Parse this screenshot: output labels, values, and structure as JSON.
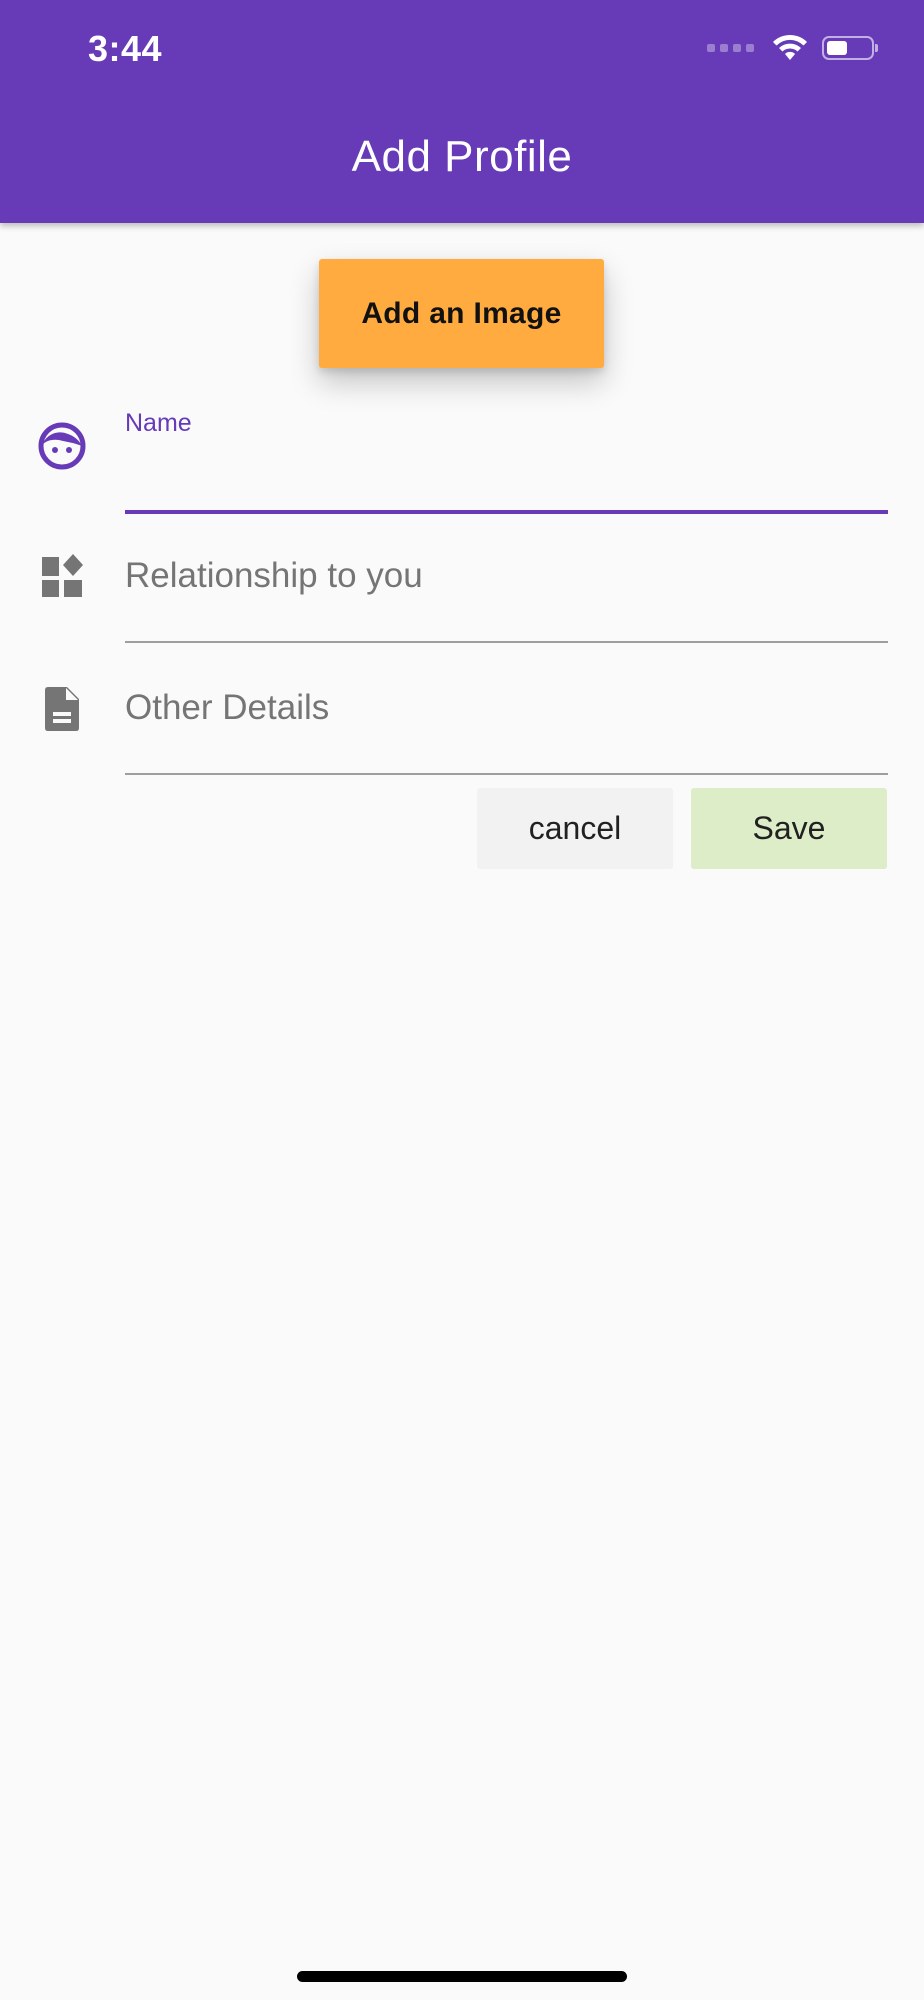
{
  "status_bar": {
    "time": "3:44"
  },
  "app_bar": {
    "title": "Add Profile",
    "color": "#673ab7"
  },
  "add_image_button": {
    "label": "Add an Image",
    "color": "#ffab40"
  },
  "form": {
    "name": {
      "label": "Name",
      "value": "",
      "icon": "face-icon"
    },
    "relationship": {
      "placeholder": "Relationship to you",
      "value": "",
      "icon": "widgets-icon"
    },
    "details": {
      "placeholder": "Other Details",
      "value": "",
      "icon": "description-icon"
    }
  },
  "actions": {
    "cancel_label": "cancel",
    "save_label": "Save",
    "save_color": "#dcedc8"
  }
}
